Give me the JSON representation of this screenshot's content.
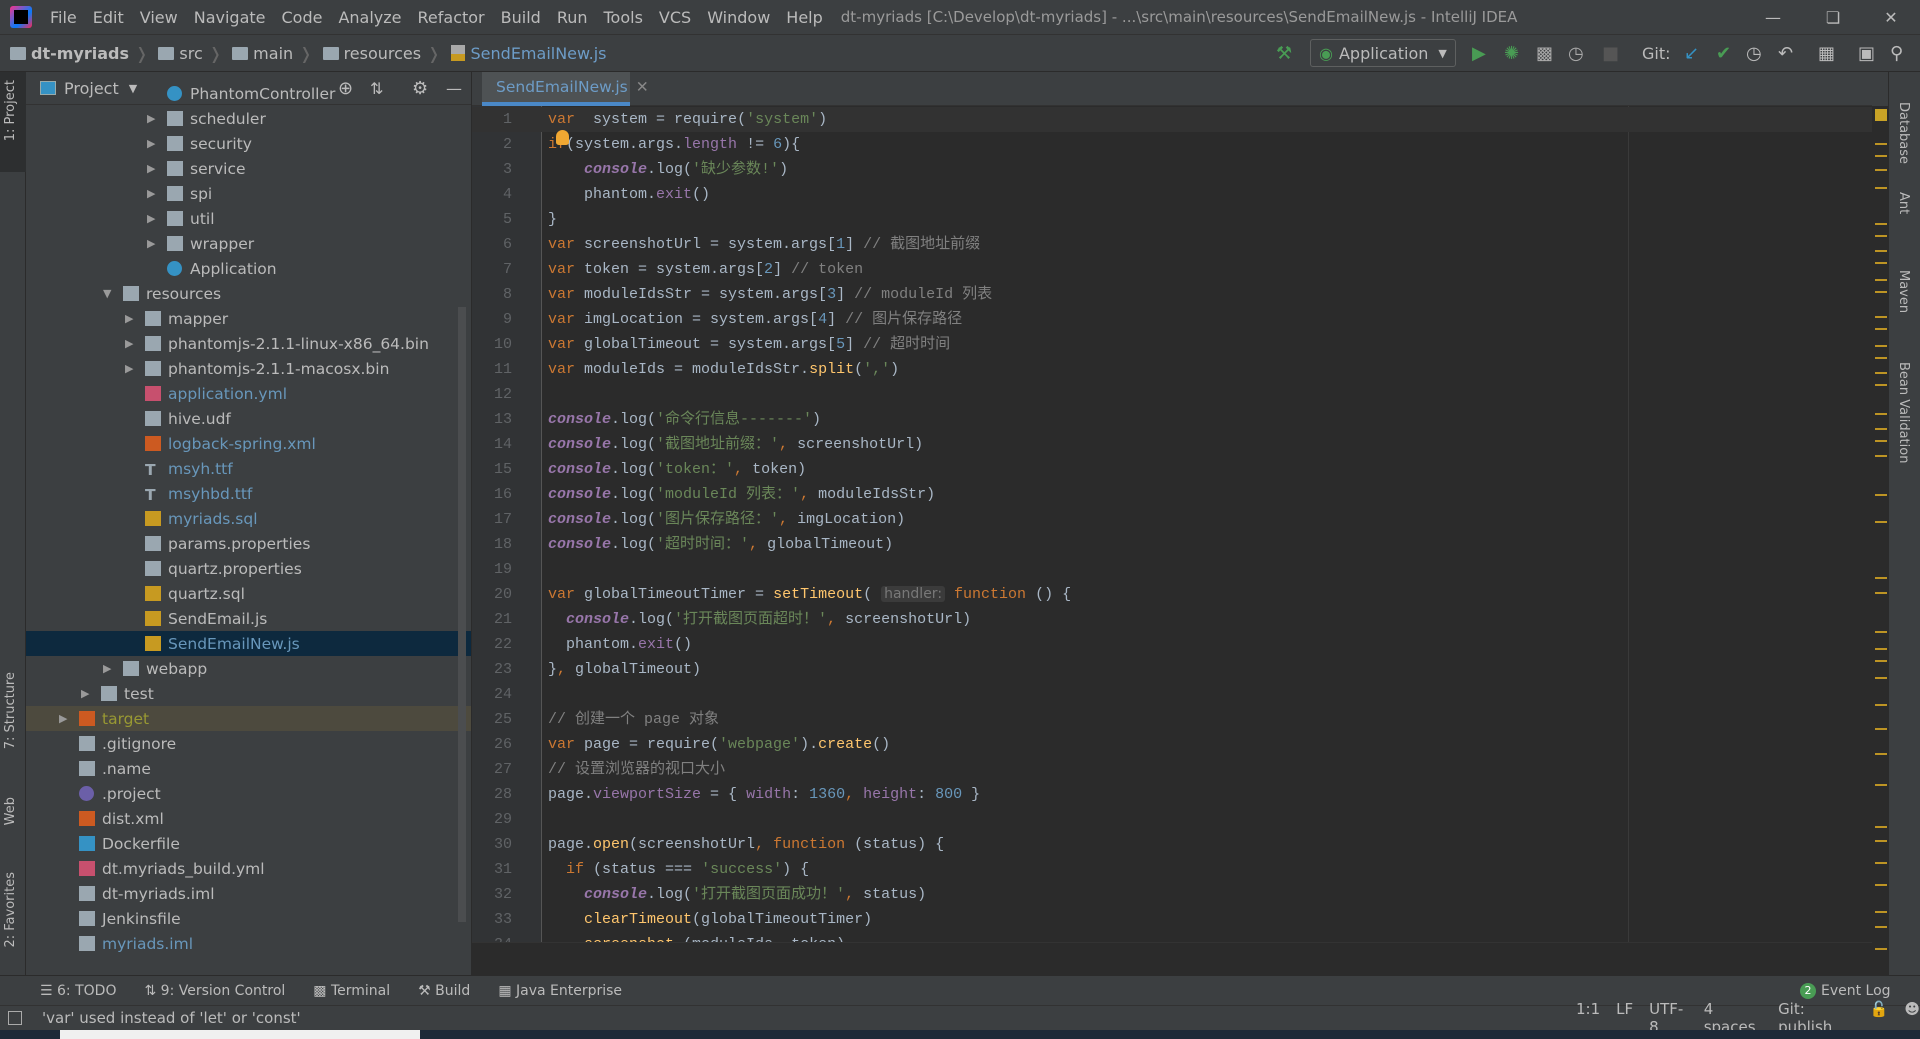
{
  "window": {
    "title": "dt-myriads [C:\\Develop\\dt-myriads] - ...\\src\\main\\resources\\SendEmailNew.js - IntelliJ IDEA"
  },
  "menu": [
    "File",
    "Edit",
    "View",
    "Navigate",
    "Code",
    "Analyze",
    "Refactor",
    "Build",
    "Run",
    "Tools",
    "VCS",
    "Window",
    "Help"
  ],
  "breadcrumb": [
    "dt-myriads",
    "src",
    "main",
    "resources",
    "SendEmailNew.js"
  ],
  "toolbar": {
    "run_config": "Application",
    "git_label": "Git:"
  },
  "project": {
    "title": "Project",
    "rows": [
      {
        "level": 4,
        "arrow": false,
        "icon": "class",
        "label": "PhantomController",
        "color": "#bbbbbb"
      },
      {
        "level": 4,
        "arrow": true,
        "icon": "package",
        "label": "scheduler",
        "color": "#bbbbbb"
      },
      {
        "level": 4,
        "arrow": true,
        "icon": "package",
        "label": "security",
        "color": "#bbbbbb"
      },
      {
        "level": 4,
        "arrow": true,
        "icon": "package",
        "label": "service",
        "color": "#bbbbbb"
      },
      {
        "level": 4,
        "arrow": true,
        "icon": "package",
        "label": "spi",
        "color": "#bbbbbb"
      },
      {
        "level": 4,
        "arrow": true,
        "icon": "package",
        "label": "util",
        "color": "#bbbbbb"
      },
      {
        "level": 4,
        "arrow": true,
        "icon": "package",
        "label": "wrapper",
        "color": "#bbbbbb"
      },
      {
        "level": 4,
        "arrow": false,
        "icon": "class",
        "label": "Application",
        "color": "#bbbbbb"
      },
      {
        "level": 2,
        "arrow": true,
        "open": true,
        "icon": "resources",
        "label": "resources",
        "color": "#bbbbbb"
      },
      {
        "level": 3,
        "arrow": true,
        "icon": "folder",
        "label": "mapper",
        "color": "#bbbbbb"
      },
      {
        "level": 3,
        "arrow": true,
        "icon": "folder",
        "label": "phantomjs-2.1.1-linux-x86_64.bin",
        "color": "#bbbbbb"
      },
      {
        "level": 3,
        "arrow": true,
        "icon": "folder",
        "label": "phantomjs-2.1.1-macosx.bin",
        "color": "#bbbbbb"
      },
      {
        "level": 3,
        "arrow": false,
        "icon": "yml",
        "label": "application.yml",
        "color": "#6897bb"
      },
      {
        "level": 3,
        "arrow": false,
        "icon": "text",
        "label": "hive.udf",
        "color": "#bbbbbb"
      },
      {
        "level": 3,
        "arrow": false,
        "icon": "xml",
        "label": "logback-spring.xml",
        "color": "#6897bb"
      },
      {
        "level": 3,
        "arrow": false,
        "icon": "font",
        "label": "msyh.ttf",
        "color": "#6897bb"
      },
      {
        "level": 3,
        "arrow": false,
        "icon": "font",
        "label": "msyhbd.ttf",
        "color": "#6897bb"
      },
      {
        "level": 3,
        "arrow": false,
        "icon": "sql",
        "label": "myriads.sql",
        "color": "#6897bb"
      },
      {
        "level": 3,
        "arrow": false,
        "icon": "properties",
        "label": "params.properties",
        "color": "#bbbbbb"
      },
      {
        "level": 3,
        "arrow": false,
        "icon": "properties",
        "label": "quartz.properties",
        "color": "#bbbbbb"
      },
      {
        "level": 3,
        "arrow": false,
        "icon": "sql",
        "label": "quartz.sql",
        "color": "#bbbbbb"
      },
      {
        "level": 3,
        "arrow": false,
        "icon": "js",
        "label": "SendEmail.js",
        "color": "#bbbbbb"
      },
      {
        "level": 3,
        "arrow": false,
        "icon": "js",
        "label": "SendEmailNew.js",
        "color": "#6897bb",
        "selected": true
      },
      {
        "level": 2,
        "arrow": true,
        "icon": "folder",
        "label": "webapp",
        "color": "#bbbbbb"
      },
      {
        "level": 1,
        "arrow": true,
        "icon": "folder",
        "label": "test",
        "color": "#bbbbbb"
      },
      {
        "level": 0,
        "arrow": true,
        "icon": "excluded",
        "label": "target",
        "color": "#999933",
        "excluded": true
      },
      {
        "level": 0,
        "arrow": false,
        "icon": "ignore",
        "label": ".gitignore",
        "color": "#bbbbbb"
      },
      {
        "level": 0,
        "arrow": false,
        "icon": "text",
        "label": ".name",
        "color": "#bbbbbb"
      },
      {
        "level": 0,
        "arrow": false,
        "icon": "eclipse",
        "label": ".project",
        "color": "#bbbbbb"
      },
      {
        "level": 0,
        "arrow": false,
        "icon": "xml",
        "label": "dist.xml",
        "color": "#bbbbbb"
      },
      {
        "level": 0,
        "arrow": false,
        "icon": "docker",
        "label": "Dockerfile",
        "color": "#bbbbbb"
      },
      {
        "level": 0,
        "arrow": false,
        "icon": "yml",
        "label": "dt.myriads_build.yml",
        "color": "#bbbbbb"
      },
      {
        "level": 0,
        "arrow": false,
        "icon": "iml",
        "label": "dt-myriads.iml",
        "color": "#bbbbbb"
      },
      {
        "level": 0,
        "arrow": false,
        "icon": "text",
        "label": "Jenkinsfile",
        "color": "#bbbbbb"
      },
      {
        "level": 0,
        "arrow": false,
        "icon": "iml",
        "label": "myriads.iml",
        "color": "#6897bb"
      }
    ]
  },
  "editor": {
    "tab": "SendEmailNew.js",
    "lines": [
      [
        [
          "kw",
          "var"
        ],
        [
          "",
          "  system = "
        ],
        [
          "",
          "require"
        ],
        [
          "",
          "("
        ],
        [
          "str",
          "'system'"
        ],
        [
          "",
          ")"
        ]
      ],
      [
        [
          "kw",
          "if"
        ],
        [
          "",
          "(system.args."
        ],
        [
          "prop",
          "length"
        ],
        [
          "",
          " != "
        ],
        [
          "num",
          "6"
        ],
        [
          "",
          "){"
        ]
      ],
      [
        [
          "",
          "    "
        ],
        [
          "con",
          "console"
        ],
        [
          "",
          ".log("
        ],
        [
          "str",
          "'缺少参数!'"
        ],
        [
          "",
          ")"
        ]
      ],
      [
        [
          "",
          "    phantom."
        ],
        [
          "prop",
          "exit"
        ],
        [
          "",
          "()"
        ]
      ],
      [
        [
          "",
          "}"
        ]
      ],
      [
        [
          "kw",
          "var"
        ],
        [
          "",
          " screenshotUrl = system.args["
        ],
        [
          "num",
          "1"
        ],
        [
          "",
          "] "
        ],
        [
          "com",
          "// 截图地址前缀"
        ]
      ],
      [
        [
          "kw",
          "var"
        ],
        [
          "",
          " token = system.args["
        ],
        [
          "num",
          "2"
        ],
        [
          "",
          "] "
        ],
        [
          "com",
          "// token"
        ]
      ],
      [
        [
          "kw",
          "var"
        ],
        [
          "",
          " moduleIdsStr = system.args["
        ],
        [
          "num",
          "3"
        ],
        [
          "",
          "] "
        ],
        [
          "com",
          "// moduleId 列表"
        ]
      ],
      [
        [
          "kw",
          "var"
        ],
        [
          "",
          " imgLocation = system.args["
        ],
        [
          "num",
          "4"
        ],
        [
          "",
          "] "
        ],
        [
          "com",
          "// 图片保存路径"
        ]
      ],
      [
        [
          "kw",
          "var"
        ],
        [
          "",
          " globalTimeout = system.args["
        ],
        [
          "num",
          "5"
        ],
        [
          "",
          "] "
        ],
        [
          "com",
          "// 超时时间"
        ]
      ],
      [
        [
          "kw",
          "var"
        ],
        [
          "",
          " moduleIds = moduleIdsStr."
        ],
        [
          "fn",
          "split"
        ],
        [
          "",
          "("
        ],
        [
          "str",
          "','"
        ],
        [
          "",
          ")"
        ]
      ],
      [],
      [
        [
          "con",
          "console"
        ],
        [
          "",
          ".log("
        ],
        [
          "str",
          "'命令行信息-------'"
        ],
        [
          "",
          ")"
        ]
      ],
      [
        [
          "con",
          "console"
        ],
        [
          "",
          ".log("
        ],
        [
          "str",
          "'截图地址前缀：'"
        ],
        [
          "kw",
          ", "
        ],
        [
          "",
          "screenshotUrl)"
        ]
      ],
      [
        [
          "con",
          "console"
        ],
        [
          "",
          ".log("
        ],
        [
          "str",
          "'token：'"
        ],
        [
          "kw",
          ", "
        ],
        [
          "",
          "token)"
        ]
      ],
      [
        [
          "con",
          "console"
        ],
        [
          "",
          ".log("
        ],
        [
          "str",
          "'moduleId 列表：'"
        ],
        [
          "kw",
          ", "
        ],
        [
          "",
          "moduleIdsStr)"
        ]
      ],
      [
        [
          "con",
          "console"
        ],
        [
          "",
          ".log("
        ],
        [
          "str",
          "'图片保存路径：'"
        ],
        [
          "kw",
          ", "
        ],
        [
          "",
          "imgLocation)"
        ]
      ],
      [
        [
          "con",
          "console"
        ],
        [
          "",
          ".log("
        ],
        [
          "str",
          "'超时时间：'"
        ],
        [
          "kw",
          ", "
        ],
        [
          "",
          "globalTimeout)"
        ]
      ],
      [],
      [
        [
          "kw",
          "var"
        ],
        [
          "",
          " globalTimeoutTimer = "
        ],
        [
          "fn",
          "setTimeout"
        ],
        [
          "",
          "( "
        ],
        [
          "hint",
          "handler:"
        ],
        [
          "kw",
          " function"
        ],
        [
          "",
          " () {"
        ]
      ],
      [
        [
          "",
          "  "
        ],
        [
          "con",
          "console"
        ],
        [
          "",
          ".log("
        ],
        [
          "str",
          "'打开截图页面超时！'"
        ],
        [
          "kw",
          ", "
        ],
        [
          "",
          "screenshotUrl)"
        ]
      ],
      [
        [
          "",
          "  phantom."
        ],
        [
          "prop",
          "exit"
        ],
        [
          "",
          "()"
        ]
      ],
      [
        [
          "",
          "}"
        ],
        [
          "kw",
          ", "
        ],
        [
          "",
          "globalTimeout)"
        ]
      ],
      [],
      [
        [
          "com",
          "// 创建一个 page 对象"
        ]
      ],
      [
        [
          "kw",
          "var"
        ],
        [
          "",
          " page = require("
        ],
        [
          "str",
          "'webpage'"
        ],
        [
          "",
          ")."
        ],
        [
          "fn",
          "create"
        ],
        [
          "",
          "()"
        ]
      ],
      [
        [
          "com",
          "// 设置浏览器的视口大小"
        ]
      ],
      [
        [
          "",
          "page."
        ],
        [
          "prop",
          "viewportSize"
        ],
        [
          "",
          " = { "
        ],
        [
          "prop",
          "width"
        ],
        [
          "",
          ": "
        ],
        [
          "num",
          "1360"
        ],
        [
          "kw",
          ", "
        ],
        [
          "prop",
          "height"
        ],
        [
          "",
          ": "
        ],
        [
          "num",
          "800"
        ],
        [
          "",
          " }"
        ]
      ],
      [],
      [
        [
          "",
          "page."
        ],
        [
          "fn",
          "open"
        ],
        [
          "",
          "(screenshotUrl"
        ],
        [
          "kw",
          ", function"
        ],
        [
          "",
          " (status) {"
        ]
      ],
      [
        [
          "",
          "  "
        ],
        [
          "kw",
          "if"
        ],
        [
          "",
          " (status === "
        ],
        [
          "str",
          "'success'"
        ],
        [
          "",
          ") {"
        ]
      ],
      [
        [
          "",
          "    "
        ],
        [
          "con",
          "console"
        ],
        [
          "",
          ".log("
        ],
        [
          "str",
          "'打开截图页面成功！'"
        ],
        [
          "kw",
          ", "
        ],
        [
          "",
          "status)"
        ]
      ],
      [
        [
          "",
          "    "
        ],
        [
          "fn",
          "clearTimeout"
        ],
        [
          "",
          "(globalTimeoutTimer)"
        ]
      ],
      [
        [
          "",
          "    "
        ],
        [
          "fn",
          "screenshot"
        ],
        [
          "",
          " (moduleIds"
        ],
        [
          "kw",
          ", "
        ],
        [
          "",
          "token)"
        ]
      ]
    ]
  },
  "left_tools": [
    "1: Project",
    "7: Structure",
    "Web",
    "2: Favorites"
  ],
  "right_tools": [
    "Database",
    "Ant",
    "Maven",
    "Bean Validation"
  ],
  "bottom_tools": [
    "6: TODO",
    "9: Version Control",
    "Terminal",
    "Build",
    "Java Enterprise"
  ],
  "event_log": {
    "label": "Event Log",
    "count": "2"
  },
  "status": {
    "message": "'var' used instead of 'let' or 'const'",
    "position": "1:1",
    "line_sep": "LF",
    "encoding": "UTF-8",
    "indent": "4 spaces",
    "git": "Git: publish"
  },
  "colors": {
    "accent": "#4a88c7",
    "keyword": "#cc7832",
    "string": "#6a8759",
    "selected_row": "#0d293e"
  }
}
